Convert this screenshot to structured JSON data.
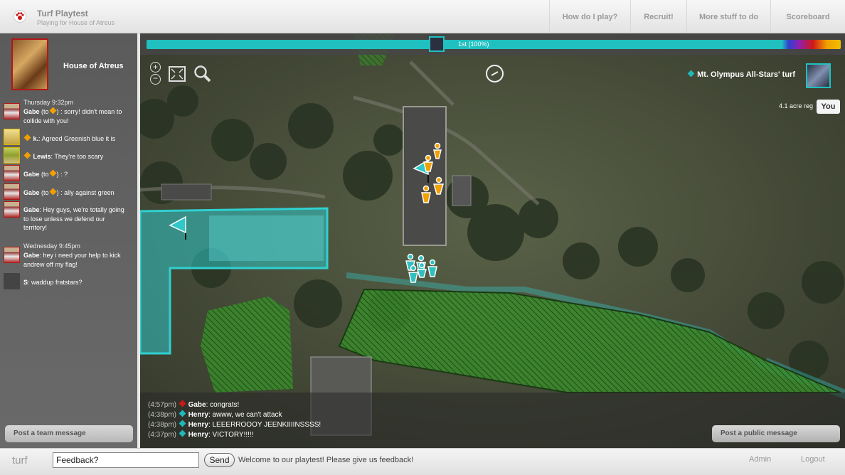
{
  "header": {
    "title": "Turf Playtest",
    "subtitle": "Playing for House of Atreus",
    "nav": [
      "How do I play?",
      "Recruit!",
      "More stuff to do",
      "Scoreboard"
    ]
  },
  "sidebar": {
    "team_name": "House of Atreus",
    "feed": [
      {
        "time": "Thursday 9:32pm",
        "author": "Gabe",
        "to": true,
        "text": ": sorry! didn't mean to collide with you!"
      },
      {
        "time": "",
        "author": "k.",
        "text": ": Agreed Greenish blue it is"
      },
      {
        "time": "",
        "author": "Lewis",
        "text": ": They're too scary"
      },
      {
        "time": "",
        "author": "Gabe",
        "to": true,
        "text": ": ?"
      },
      {
        "time": "",
        "author": "Gabe",
        "to": true,
        "text": ": ally against green"
      },
      {
        "time": "",
        "author": "Gabe",
        "text": ": Hey guys, we're totally going to lose unless we defend our territory!"
      },
      {
        "time": "Wednesday 9:45pm",
        "author": "Gabe",
        "text": ": hey i need your help to kick andrew off my flag!"
      },
      {
        "time": "",
        "author": "S",
        "text": ": waddup fratstars?"
      }
    ],
    "to_prefix": "(to",
    "to_suffix": ")",
    "team_message_button": "Post a team message"
  },
  "map": {
    "progress_label": "1st (100%)",
    "progress": 0.915,
    "turf_owner": "Mt. Olympus All-Stars' turf",
    "acre_text": "4.1 acre reg",
    "you_label": "You",
    "chat": [
      {
        "time": "(4:57pm)",
        "author": "Gabe",
        "text": ": congrats!",
        "color": "#d01818"
      },
      {
        "time": "(4:38pm)",
        "author": "Henry",
        "text": ": awww, we can't attack",
        "color": "#20b8b8"
      },
      {
        "time": "(4:38pm)",
        "author": "Henry",
        "text": ": LEEERROOOY JEENKIIIINSSSS!",
        "color": "#20b8b8"
      },
      {
        "time": "(4:37pm)",
        "author": "Henry",
        "text": ": VICTORY!!!!!",
        "color": "#20b8b8"
      }
    ],
    "public_message_button": "Post a public message"
  },
  "footer": {
    "brand": "turf",
    "feedback_value": "Feedback?",
    "send_label": "Send",
    "welcome": "Welcome to our playtest! Please give us feedback!",
    "admin": "Admin",
    "logout": "Logout"
  },
  "colors": {
    "team_teal": "#20c0c0",
    "team_orange": "#f0a000",
    "team_red": "#d01818",
    "team_green": "#3a9a30"
  },
  "icons": [
    "paw-icon",
    "zoom-in-icon",
    "zoom-out-icon",
    "fullscreen-icon",
    "search-icon",
    "compass-icon",
    "flag-icon",
    "diamond-icon"
  ]
}
